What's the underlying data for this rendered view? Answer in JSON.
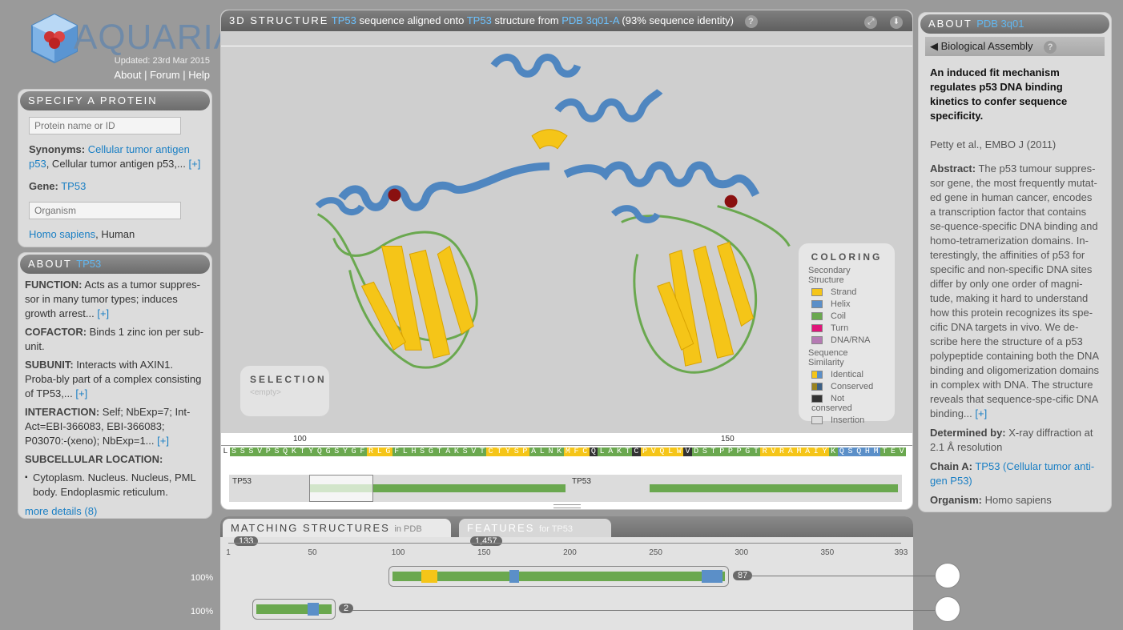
{
  "logo": {
    "text": "AQUARIA",
    "updated": "Updated: 23rd Mar 2015",
    "links": [
      "About",
      "Forum",
      "Help"
    ]
  },
  "specify": {
    "title": "SPECIFY A PROTEIN",
    "protein_placeholder": "Protein name or ID",
    "synonyms_label": "Synonyms:",
    "synonyms_link": "Cellular tumor antigen p53",
    "synonyms_rest": ", Cellular tumor antigen p53,...",
    "more": "[+]",
    "gene_label": "Gene:",
    "gene_value": "TP53",
    "organism_placeholder": "Organism",
    "organism_link": "Homo sapiens",
    "organism_rest": ", Human"
  },
  "about_left": {
    "title": "ABOUT",
    "title_hl": "TP53",
    "function_label": "FUNCTION:",
    "function_text": "Acts as a tumor suppres-sor in many tumor types; induces growth arrest...",
    "cofactor_label": "COFACTOR:",
    "cofactor_text": "Binds 1 zinc ion per sub-unit.",
    "subunit_label": "SUBUNIT:",
    "subunit_text": "Interacts with AXIN1. Proba-bly part of a complex consisting of TP53,...",
    "interaction_label": "INTERACTION:",
    "interaction_text": "Self; NbExp=7; Int-Act=EBI-366083, EBI-366083; P03070:-(xeno); NbExp=1...",
    "subcell_label": "SUBCELLULAR LOCATION:",
    "subcell_item": "Cytoplasm. Nucleus. Nucleus, PML body. Endoplasmic reticulum.",
    "more": "[+]",
    "more_details": "more details (8)"
  },
  "viewer": {
    "title": "3D STRUCTURE",
    "gene1": "TP53",
    "mid": "sequence aligned onto",
    "gene2": "TP53",
    "mid2": "structure from",
    "pdb": "PDB 3q01-A",
    "identity": "(93% sequence identity)",
    "help": "?"
  },
  "coloring": {
    "title": "COLORING",
    "secondary_title": "Secondary Structure",
    "secondary": [
      {
        "label": "Strand",
        "color": "#f5c518"
      },
      {
        "label": "Helix",
        "color": "#5b8fc8"
      },
      {
        "label": "Coil",
        "color": "#6aa84f"
      },
      {
        "label": "Turn",
        "color": "#e0157a"
      },
      {
        "label": "DNA/RNA",
        "color": "#b57ab3"
      }
    ],
    "similarity_title": "Sequence Similarity",
    "similarity": [
      {
        "label": "Identical"
      },
      {
        "label": "Conserved"
      },
      {
        "label": "Not conserved"
      },
      {
        "label": "Insertion"
      }
    ]
  },
  "selection": {
    "title": "SELECTION",
    "value": "<empty>"
  },
  "sequence": {
    "ruler": [
      "100",
      "150"
    ],
    "residues": "LSSSVPSQKTYQGSYGFRLGFLHSGTAKSVTCTYSPALNKMFCQLAKTCPVQLWVDSTPPPGTRVRAMAIYKQSQHMTEV",
    "map_labels": [
      "TP53",
      "TP53"
    ]
  },
  "about_right": {
    "title": "ABOUT",
    "title_hl": "PDB 3q01",
    "assembly": "Biological Assembly",
    "help": "?",
    "paper_title": "An induced fit mechanism regulates p53 DNA binding kinetics to confer sequence specificity.",
    "citation": "Petty et al., EMBO J (2011)",
    "abstract_label": "Abstract:",
    "abstract_text": "The p53 tumour suppres-sor gene, the most frequently mutat-ed gene in human cancer, encodes a transcription factor that contains se-quence-specific DNA binding and homo-tetramerization domains. In-terestingly, the affinities of p53 for specific and non-specific DNA sites differ by only one order of magni-tude, making it hard to understand how this protein recognizes its spe-cific DNA targets in vivo. We de-scribe here the structure of a p53 polypeptide containing both the DNA binding and oligomerization domains in complex with DNA. The structure reveals that sequence-spe-cific DNA binding...",
    "more": "[+]",
    "determined_label": "Determined by:",
    "determined_text": "X-ray diffraction at 2.1 Å resolution",
    "chain_label": "Chain A:",
    "chain_link": "TP53 (Cellular tumor anti-gen P53)",
    "organism_label": "Organism:",
    "organism_text": "Homo sapiens"
  },
  "bottom": {
    "tab1": "MATCHING STRUCTURES",
    "tab1_sub": "in PDB",
    "tab1_count": "133",
    "tab2": "FEATURES",
    "tab2_sub": "for TP53",
    "tab2_count": "1,457",
    "scale": [
      "1",
      "50",
      "100",
      "150",
      "200",
      "250",
      "300",
      "350",
      "393"
    ],
    "rows": [
      {
        "pct": "100%",
        "count": "87"
      },
      {
        "pct": "100%",
        "count": "2"
      }
    ]
  }
}
